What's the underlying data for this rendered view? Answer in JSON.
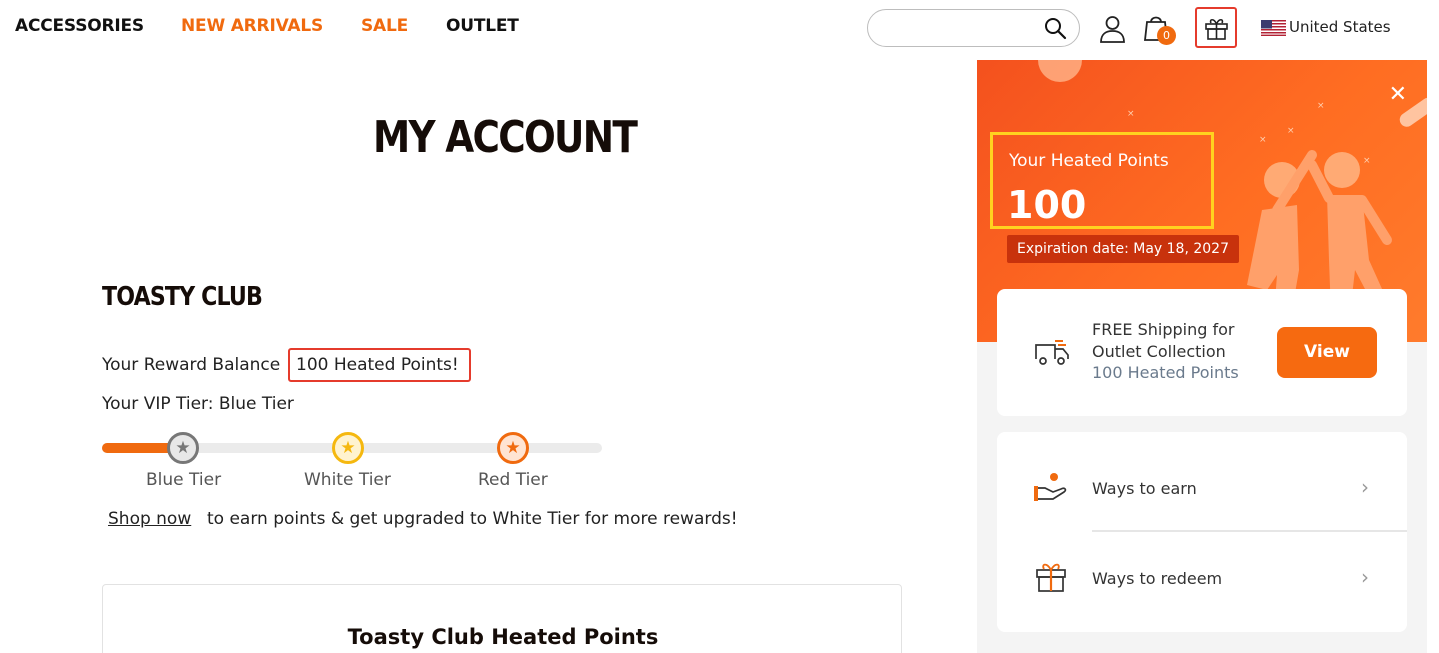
{
  "nav": {
    "items": [
      {
        "label": "ACCESSORIES",
        "color": "#111111"
      },
      {
        "label": "NEW ARRIVALS",
        "color": "#f06a0f"
      },
      {
        "label": "SALE",
        "color": "#f06a0f"
      },
      {
        "label": "OUTLET",
        "color": "#111111"
      }
    ]
  },
  "header": {
    "search_placeholder": "",
    "cart_count": "0",
    "country": "United States",
    "icons": [
      "search-icon",
      "user-icon",
      "cart-icon",
      "gift-icon",
      "us-flag-icon"
    ]
  },
  "main": {
    "page_title": "MY ACCOUNT",
    "club_title": "TOASTY CLUB",
    "balance_prefix": "Your Reward Balance",
    "balance_value": "100 Heated Points!",
    "vip_tier": "Your VIP Tier: Blue Tier",
    "tier_progress_fraction": 0.16,
    "tiers": [
      {
        "label": "Blue Tier",
        "color": "#777777",
        "icon": "star-icon"
      },
      {
        "label": "White Tier",
        "color": "#f5b80f",
        "icon": "star-icon"
      },
      {
        "label": "Red Tier",
        "color": "#f06a0f",
        "icon": "star-icon"
      }
    ],
    "shop_now": "Shop now",
    "shop_text": "to earn points & get upgraded to White Tier for more rewards!",
    "card_title": "Toasty Club Heated Points"
  },
  "panel": {
    "points_label": "Your Heated Points",
    "points_value": "100",
    "expiration": "Expiration date: May 18, 2027",
    "offer_line1": "FREE Shipping for",
    "offer_line2": "Outlet Collection",
    "offer_points": "100 Heated Points",
    "view_label": "View",
    "ways_to_earn": "Ways to earn",
    "ways_to_redeem": "Ways to redeem",
    "colors": {
      "accent": "#f06a0f",
      "highlight": "#ffd21f",
      "outline": "#e53b2c"
    }
  }
}
